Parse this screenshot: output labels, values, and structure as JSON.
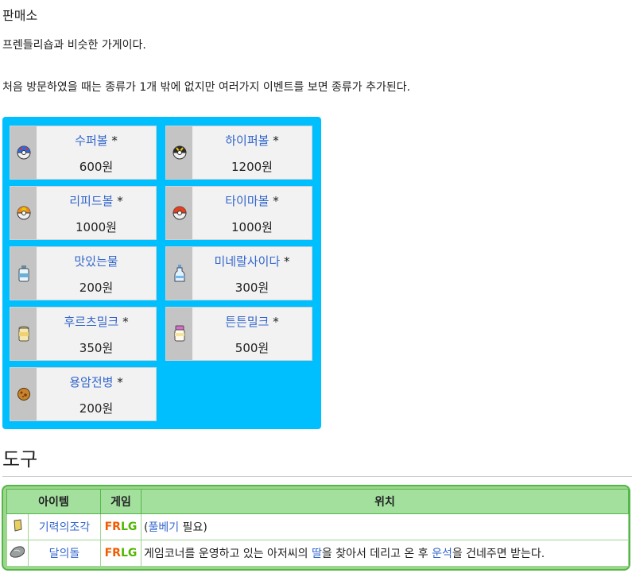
{
  "section": {
    "title": "판매소",
    "desc1": "프렌들리숍과 비슷한 가게이다.",
    "desc2": "처음 방문하였을 때는 종류가 1개 밖에 없지만 여러가지 이벤트를 보면 종류가 추가된다."
  },
  "shop": {
    "bg_color": "#00bfff",
    "items": [
      {
        "name": "수퍼볼",
        "star": "*",
        "price": "600원",
        "icon": "super-ball-icon"
      },
      {
        "name": "하이퍼볼",
        "star": "*",
        "price": "1200원",
        "icon": "hyper-ball-icon"
      },
      {
        "name": "리피드볼",
        "star": "*",
        "price": "1000원",
        "icon": "repeat-ball-icon"
      },
      {
        "name": "타이마볼",
        "star": "*",
        "price": "1000원",
        "icon": "timer-ball-icon"
      },
      {
        "name": "맛있는물",
        "star": "",
        "price": "200원",
        "icon": "fresh-water-icon"
      },
      {
        "name": "미네랄사이다",
        "star": "*",
        "price": "300원",
        "icon": "soda-pop-icon"
      },
      {
        "name": "후르츠밀크",
        "star": "*",
        "price": "350원",
        "icon": "lemonade-icon"
      },
      {
        "name": "튼튼밀크",
        "star": "*",
        "price": "500원",
        "icon": "moomoo-milk-icon"
      },
      {
        "name": "용암전병",
        "star": "*",
        "price": "200원",
        "icon": "lava-cookie-icon"
      }
    ]
  },
  "tools": {
    "heading": "도구",
    "headers": {
      "item": "아이템",
      "game": "게임",
      "location": "위치"
    },
    "rows": [
      {
        "icon": "energy-root-icon",
        "name": "기력의조각",
        "game_fr": "FR",
        "game_lg": "LG",
        "loc_pre": "(",
        "loc_link1": "풀베기",
        "loc_mid1": " 필요)",
        "loc_link2": "",
        "loc_mid2": "",
        "loc_link3": "",
        "loc_post": ""
      },
      {
        "icon": "moon-stone-icon",
        "name": "달의돌",
        "game_fr": "FR",
        "game_lg": "LG",
        "loc_pre": "게임코너를 운영하고 있는 아저씨의 ",
        "loc_link1": "딸",
        "loc_mid1": "을 찾아서 데리고 온 후 ",
        "loc_link2": "운석",
        "loc_mid2": "을 건네주면 받는다.",
        "loc_link3": "",
        "loc_post": ""
      }
    ]
  },
  "colors": {
    "link": "#3366cc",
    "fr": "#f15c01",
    "lg": "#4fb700",
    "table_border": "#55b649",
    "table_header": "#a3e09e"
  }
}
